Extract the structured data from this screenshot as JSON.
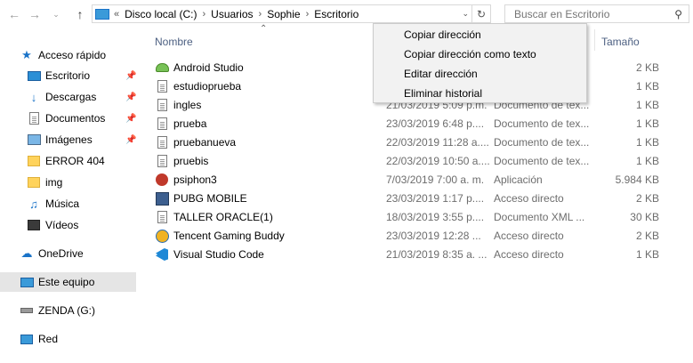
{
  "nav": {
    "back_icon": "arrow-left-icon",
    "forward_icon": "arrow-right-icon",
    "recent_icon": "chevron-down-icon",
    "up_icon": "arrow-up-icon"
  },
  "address": {
    "overflow": "«",
    "segments": [
      "Disco local (C:)",
      "Usuarios",
      "Sophie",
      "Escritorio"
    ],
    "separator": "›",
    "refresh_icon": "refresh-icon"
  },
  "search": {
    "placeholder": "Buscar en Escritorio"
  },
  "sidebar": {
    "quick_access": "Acceso rápido",
    "items": [
      {
        "label": "Escritorio",
        "pinned": true
      },
      {
        "label": "Descargas",
        "pinned": true
      },
      {
        "label": "Documentos",
        "pinned": true
      },
      {
        "label": "Imágenes",
        "pinned": true
      },
      {
        "label": "ERROR 404"
      },
      {
        "label": "img"
      },
      {
        "label": "Música"
      },
      {
        "label": "Vídeos"
      }
    ],
    "onedrive": "OneDrive",
    "this_pc": "Este equipo",
    "drive": "ZENDA (G:)",
    "network": "Red"
  },
  "columns": {
    "name": "Nombre",
    "size": "Tamaño"
  },
  "files": [
    {
      "name": "Android Studio",
      "date": "",
      "type": "",
      "size": "2 KB",
      "icon": "android-studio-icon"
    },
    {
      "name": "estudioprueba",
      "date": "",
      "type": "",
      "size": "1 KB",
      "icon": "text-file-icon"
    },
    {
      "name": "ingles",
      "date": "21/03/2019 5:09 p.m.",
      "type": "Documento de tex...",
      "size": "1 KB",
      "icon": "text-file-icon"
    },
    {
      "name": "prueba",
      "date": "23/03/2019 6:48 p....",
      "type": "Documento de tex...",
      "size": "1 KB",
      "icon": "text-file-icon"
    },
    {
      "name": "pruebanueva",
      "date": "22/03/2019 11:28 a....",
      "type": "Documento de tex...",
      "size": "1 KB",
      "icon": "text-file-icon"
    },
    {
      "name": "pruebis",
      "date": "22/03/2019 10:50 a....",
      "type": "Documento de tex...",
      "size": "1 KB",
      "icon": "text-file-icon"
    },
    {
      "name": "psiphon3",
      "date": "7/03/2019 7:00 a. m.",
      "type": "Aplicación",
      "size": "5.984 KB",
      "icon": "psiphon-icon"
    },
    {
      "name": "PUBG MOBILE",
      "date": "23/03/2019 1:17 p....",
      "type": "Acceso directo",
      "size": "2 KB",
      "icon": "pubg-icon"
    },
    {
      "name": "TALLER ORACLE(1)",
      "date": "18/03/2019 3:55 p....",
      "type": "Documento XML ...",
      "size": "30 KB",
      "icon": "xml-file-icon"
    },
    {
      "name": "Tencent Gaming Buddy",
      "date": "23/03/2019 12:28 ...",
      "type": "Acceso directo",
      "size": "2 KB",
      "icon": "tencent-icon"
    },
    {
      "name": "Visual Studio Code",
      "date": "21/03/2019 8:35 a. ...",
      "type": "Acceso directo",
      "size": "1 KB",
      "icon": "vscode-icon"
    }
  ],
  "context_menu": {
    "items": [
      "Copiar dirección",
      "Copiar dirección como texto",
      "Editar dirección",
      "Eliminar historial"
    ]
  }
}
